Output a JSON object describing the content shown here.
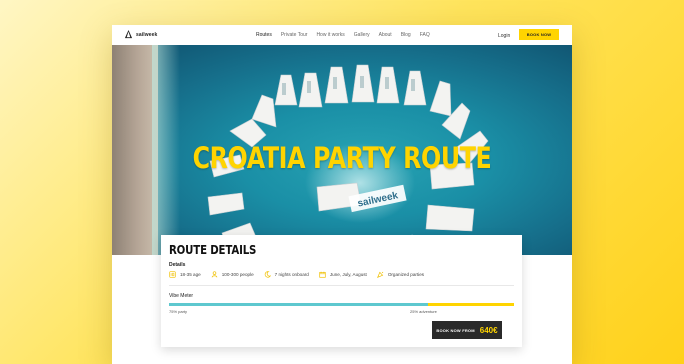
{
  "brand": {
    "name": "sailweek"
  },
  "nav": {
    "items": [
      "Routes",
      "Private Tour",
      "How it works",
      "Gallery",
      "About",
      "Blog",
      "FAQ"
    ],
    "active_index": 0,
    "login": "Login",
    "book_now": "BOOK NOW"
  },
  "hero": {
    "title": "CROATIA PARTY ROUTE",
    "boat_banner": "sailweek"
  },
  "route": {
    "title": "ROUTE DETAILS",
    "details_label": "Details",
    "details": [
      {
        "icon": "age-icon",
        "text": "18-35 age"
      },
      {
        "icon": "people-icon",
        "text": "100-300 people"
      },
      {
        "icon": "moon-icon",
        "text": "7 nights onboard"
      },
      {
        "icon": "calendar-icon",
        "text": "June, July, August"
      },
      {
        "icon": "party-icon",
        "text": "Organized parties"
      }
    ],
    "vibe": {
      "label": "Vibe Meter",
      "party_fraction": 0.75,
      "adventure_fraction": 0.25,
      "party_label": "75% party",
      "adventure_label": "25% adventure"
    },
    "cta": {
      "label": "BOOK NOW FROM",
      "price": "640€"
    }
  },
  "colors": {
    "accent": "#ffd400",
    "party_bar": "#5ec8cf",
    "cta_bg": "#2a2a2a"
  }
}
